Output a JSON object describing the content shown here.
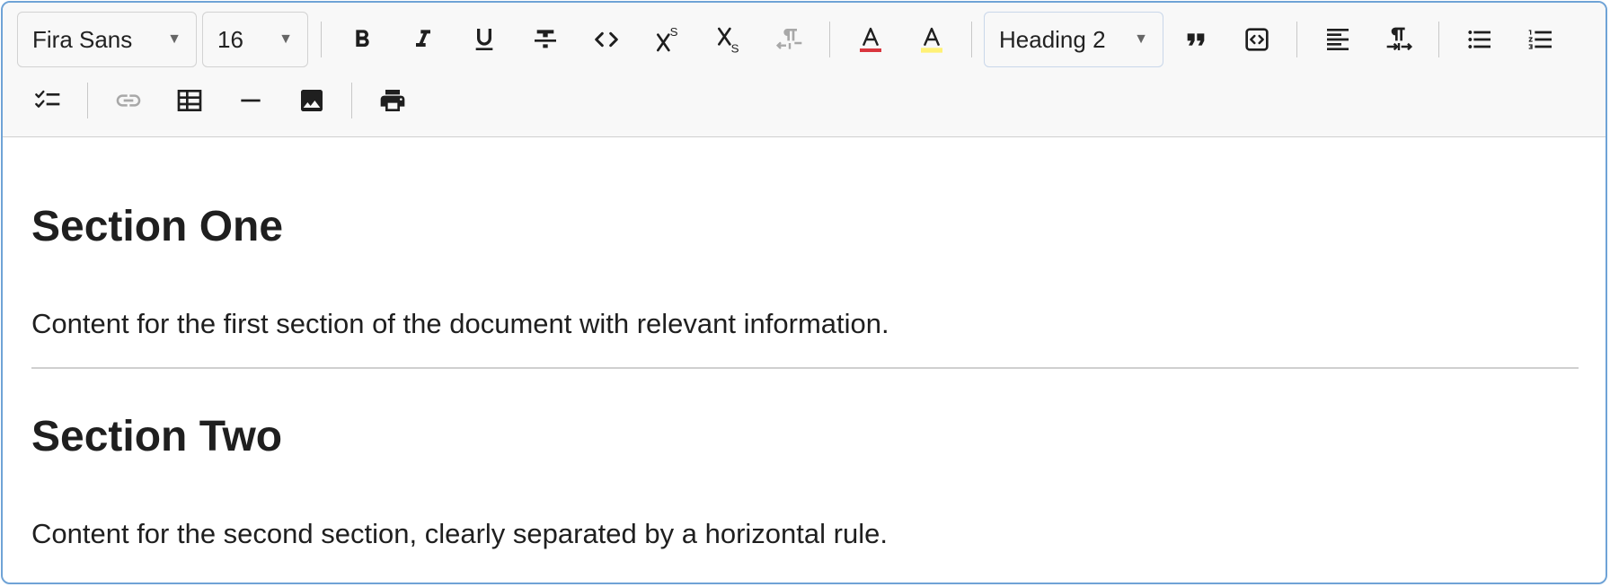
{
  "toolbar": {
    "font_family": "Fira Sans",
    "font_size": "16",
    "block_format": "Heading 2",
    "caret": "▼",
    "colors": {
      "text_color_bar": "#d9363e",
      "highlight_bar": "#fff176",
      "disabled_icon": "#a8a8a8",
      "icon": "#1f1f1f"
    },
    "buttons": [
      {
        "icon": "bold-icon"
      },
      {
        "icon": "italic-icon"
      },
      {
        "icon": "underline-icon"
      },
      {
        "icon": "strikethrough-icon"
      },
      {
        "icon": "code-icon"
      },
      {
        "icon": "superscript-icon"
      },
      {
        "icon": "subscript-icon"
      },
      {
        "icon": "text-direction-icon",
        "disabled": true
      },
      {
        "icon": "text-color-icon"
      },
      {
        "icon": "highlight-color-icon"
      },
      {
        "icon": "blockquote-icon"
      },
      {
        "icon": "code-block-icon"
      },
      {
        "icon": "align-left-icon"
      },
      {
        "icon": "ltr-paragraph-icon"
      },
      {
        "icon": "bullet-list-icon"
      },
      {
        "icon": "numbered-list-icon"
      },
      {
        "icon": "checklist-icon"
      },
      {
        "icon": "link-icon",
        "disabled": true
      },
      {
        "icon": "table-icon"
      },
      {
        "icon": "horizontal-rule-icon"
      },
      {
        "icon": "image-icon"
      },
      {
        "icon": "print-icon"
      }
    ]
  },
  "document": {
    "section_one_heading": "Section One",
    "section_one_text": "Content for the first section of the document with relevant information.",
    "section_two_heading": "Section Two",
    "section_two_text": "Content for the second section, clearly separated by a horizontal rule."
  }
}
